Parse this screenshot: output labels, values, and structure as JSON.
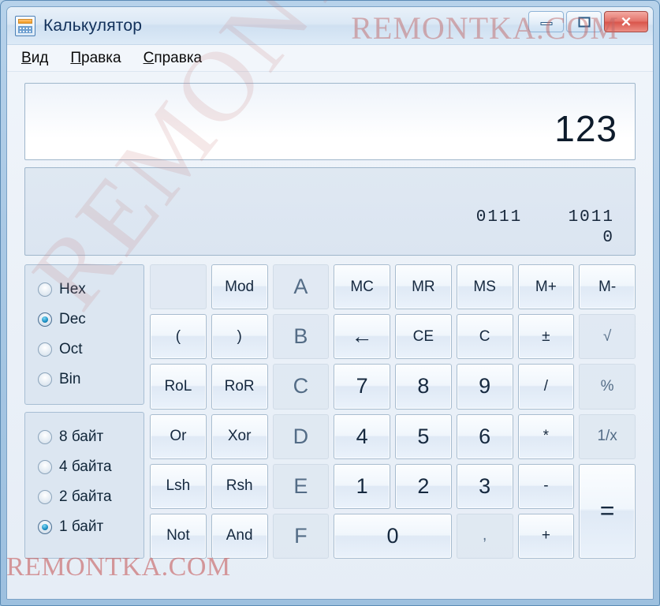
{
  "window": {
    "title": "Калькулятор",
    "icon": "calculator-icon",
    "controls": {
      "minimize": "minimize-icon",
      "maximize": "maximize-icon",
      "close": "✕"
    }
  },
  "menu": {
    "items": [
      {
        "prefix": "В",
        "rest": "ид",
        "label": "Вид"
      },
      {
        "prefix": "П",
        "rest": "равка",
        "label": "Правка"
      },
      {
        "prefix": "С",
        "rest": "правка",
        "label": "Справка"
      }
    ]
  },
  "display": {
    "value": "123",
    "binary_line1": "0111    1011",
    "binary_line2": "0"
  },
  "base_group": {
    "options": [
      {
        "label": "Hex",
        "checked": false
      },
      {
        "label": "Dec",
        "checked": true
      },
      {
        "label": "Oct",
        "checked": false
      },
      {
        "label": "Bin",
        "checked": false
      }
    ]
  },
  "size_group": {
    "options": [
      {
        "label": "8 байт",
        "checked": false
      },
      {
        "label": "4 байта",
        "checked": false
      },
      {
        "label": "2 байта",
        "checked": false
      },
      {
        "label": "1 байт",
        "checked": true
      }
    ]
  },
  "keypad": {
    "buttons": [
      {
        "label": "",
        "name": "blank-button",
        "enabled": false,
        "style": "blank"
      },
      {
        "label": "Mod",
        "name": "mod-button",
        "enabled": true,
        "style": "small"
      },
      {
        "label": "A",
        "name": "hex-a-button",
        "enabled": false,
        "style": "digit"
      },
      {
        "label": "MC",
        "name": "memory-clear-button",
        "enabled": true,
        "style": "small"
      },
      {
        "label": "MR",
        "name": "memory-recall-button",
        "enabled": true,
        "style": "small"
      },
      {
        "label": "MS",
        "name": "memory-store-button",
        "enabled": true,
        "style": "small"
      },
      {
        "label": "M+",
        "name": "memory-add-button",
        "enabled": true,
        "style": "small"
      },
      {
        "label": "M-",
        "name": "memory-subtract-button",
        "enabled": true,
        "style": "small"
      },
      {
        "label": "(",
        "name": "open-paren-button",
        "enabled": true,
        "style": "small"
      },
      {
        "label": ")",
        "name": "close-paren-button",
        "enabled": true,
        "style": "small"
      },
      {
        "label": "B",
        "name": "hex-b-button",
        "enabled": false,
        "style": "digit"
      },
      {
        "label": "←",
        "name": "backspace-button",
        "enabled": true,
        "style": "arrow"
      },
      {
        "label": "CE",
        "name": "clear-entry-button",
        "enabled": true,
        "style": "small"
      },
      {
        "label": "C",
        "name": "clear-button",
        "enabled": true,
        "style": "small"
      },
      {
        "label": "±",
        "name": "sign-toggle-button",
        "enabled": true,
        "style": "small"
      },
      {
        "label": "√",
        "name": "sqrt-button",
        "enabled": false,
        "style": "small"
      },
      {
        "label": "RoL",
        "name": "rotate-left-button",
        "enabled": true,
        "style": "small"
      },
      {
        "label": "RoR",
        "name": "rotate-right-button",
        "enabled": true,
        "style": "small"
      },
      {
        "label": "C",
        "name": "hex-c-button",
        "enabled": false,
        "style": "digit"
      },
      {
        "label": "7",
        "name": "digit-7-button",
        "enabled": true,
        "style": "digit"
      },
      {
        "label": "8",
        "name": "digit-8-button",
        "enabled": true,
        "style": "digit"
      },
      {
        "label": "9",
        "name": "digit-9-button",
        "enabled": true,
        "style": "digit"
      },
      {
        "label": "/",
        "name": "divide-button",
        "enabled": true,
        "style": "small"
      },
      {
        "label": "%",
        "name": "percent-button",
        "enabled": false,
        "style": "small"
      },
      {
        "label": "Or",
        "name": "or-button",
        "enabled": true,
        "style": "small"
      },
      {
        "label": "Xor",
        "name": "xor-button",
        "enabled": true,
        "style": "small"
      },
      {
        "label": "D",
        "name": "hex-d-button",
        "enabled": false,
        "style": "digit"
      },
      {
        "label": "4",
        "name": "digit-4-button",
        "enabled": true,
        "style": "digit"
      },
      {
        "label": "5",
        "name": "digit-5-button",
        "enabled": true,
        "style": "digit"
      },
      {
        "label": "6",
        "name": "digit-6-button",
        "enabled": true,
        "style": "digit"
      },
      {
        "label": "*",
        "name": "multiply-button",
        "enabled": true,
        "style": "small"
      },
      {
        "label": "1/x",
        "name": "reciprocal-button",
        "enabled": false,
        "style": "small"
      },
      {
        "label": "Lsh",
        "name": "left-shift-button",
        "enabled": true,
        "style": "small"
      },
      {
        "label": "Rsh",
        "name": "right-shift-button",
        "enabled": true,
        "style": "small"
      },
      {
        "label": "E",
        "name": "hex-e-button",
        "enabled": false,
        "style": "digit"
      },
      {
        "label": "1",
        "name": "digit-1-button",
        "enabled": true,
        "style": "digit"
      },
      {
        "label": "2",
        "name": "digit-2-button",
        "enabled": true,
        "style": "digit"
      },
      {
        "label": "3",
        "name": "digit-3-button",
        "enabled": true,
        "style": "digit"
      },
      {
        "label": "-",
        "name": "subtract-button",
        "enabled": true,
        "style": "small"
      },
      {
        "label": "=",
        "name": "equals-button",
        "enabled": true,
        "style": "equals",
        "span": "2row"
      },
      {
        "label": "Not",
        "name": "not-button",
        "enabled": true,
        "style": "small"
      },
      {
        "label": "And",
        "name": "and-button",
        "enabled": true,
        "style": "small"
      },
      {
        "label": "F",
        "name": "hex-f-button",
        "enabled": false,
        "style": "digit"
      },
      {
        "label": "0",
        "name": "digit-0-button",
        "enabled": true,
        "style": "digit",
        "span": "2col"
      },
      {
        "label": ",",
        "name": "decimal-point-button",
        "enabled": false,
        "style": "small"
      },
      {
        "label": "+",
        "name": "add-button",
        "enabled": true,
        "style": "small"
      }
    ]
  },
  "watermarks": {
    "top": "REMONTKA.COM",
    "diagonal": "REMONTKA.COM",
    "bottom": "REMONTKA.COM"
  }
}
